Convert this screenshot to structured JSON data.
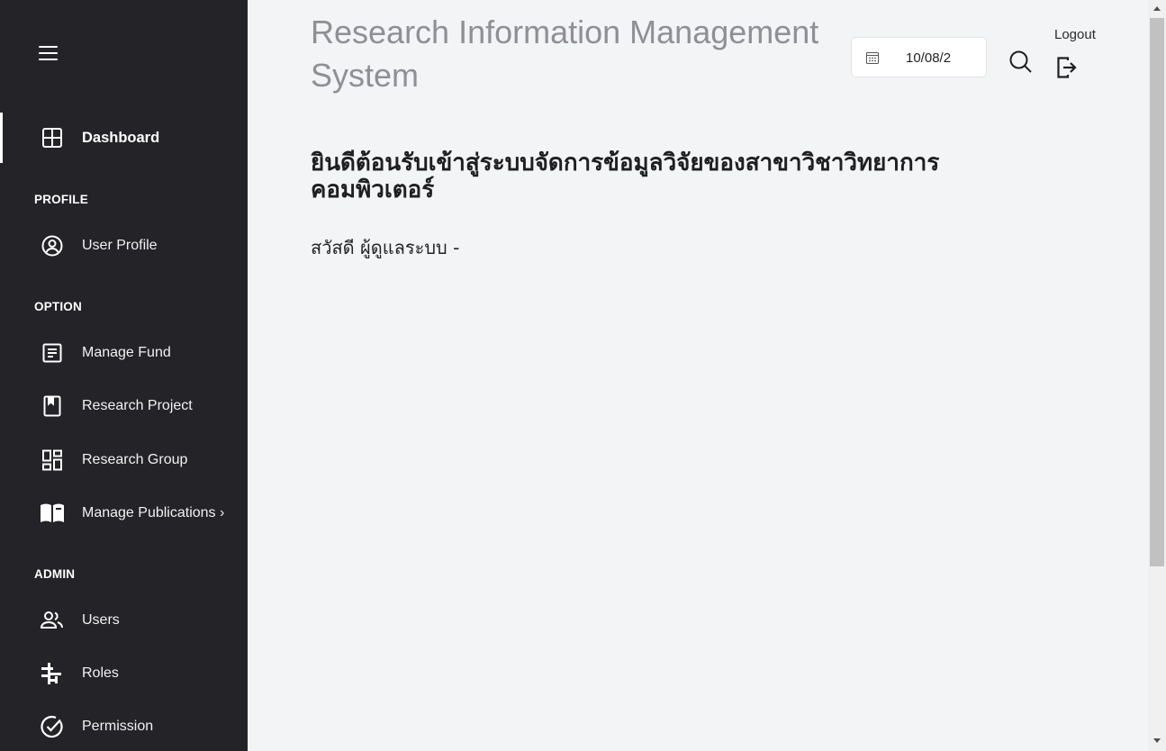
{
  "sidebar": {
    "menu_icon": "hamburger-icon",
    "dashboard": {
      "label": "Dashboard",
      "icon": "dashboard-grid-icon"
    },
    "sections": {
      "profile": "PROFILE",
      "option": "OPTION",
      "admin": "ADMIN"
    },
    "profile_items": [
      {
        "label": "User Profile",
        "icon": "user-circle-icon"
      }
    ],
    "option_items": [
      {
        "label": "Manage Fund",
        "icon": "document-list-icon"
      },
      {
        "label": "Research Project",
        "icon": "bookmark-book-icon"
      },
      {
        "label": "Research Group",
        "icon": "layout-blocks-icon"
      },
      {
        "label": "Manage Publications",
        "icon": "open-book-icon",
        "chevron": "›"
      }
    ],
    "admin_items": [
      {
        "label": "Users",
        "icon": "users-icon"
      },
      {
        "label": "Roles",
        "icon": "roles-tune-icon"
      },
      {
        "label": "Permission",
        "icon": "check-circle-icon"
      }
    ]
  },
  "header": {
    "title": "Research Information Management System",
    "date_value": "10/08/2",
    "search_icon": "search-icon",
    "logout_label": "Logout",
    "logout_icon": "logout-icon",
    "calendar_icon": "calendar-icon"
  },
  "content": {
    "welcome": "ยินดีต้อนรับเข้าสู่ระบบจัดการข้อมูลวิจัยของสาขาวิชาวิทยาการคอมพิวเตอร์",
    "greeting": "สวัสดี ผู้ดูแลระบบ -"
  },
  "colors": {
    "sidebar_bg": "#232328",
    "main_bg": "#f3f4f6",
    "title_gray": "#8f8f95"
  }
}
